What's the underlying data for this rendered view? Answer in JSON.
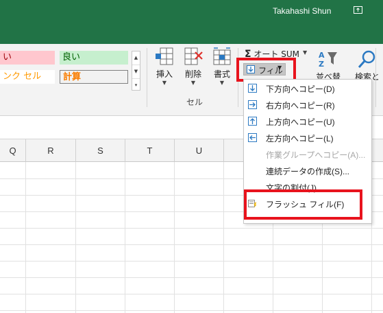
{
  "titlebar": {
    "user_name": "Takahashi Shun",
    "share_icon": "share-icon",
    "bg_color": "#217346"
  },
  "styles": {
    "bad_label": "い",
    "good_label": "良い",
    "link_label": "ンク セル",
    "calc_label": "計算"
  },
  "cells_group": {
    "insert_label": "挿入",
    "delete_label": "削除",
    "format_label": "書式",
    "group_label": "セル"
  },
  "editing_group": {
    "autosum_label": "オート SUM",
    "fill_label": "フィル",
    "sort_label": "並べ替えと",
    "find_label": "検索と"
  },
  "columns": [
    "Q",
    "R",
    "S",
    "T",
    "U"
  ],
  "fill_menu": {
    "items": [
      {
        "label": "下方向へコピー(D)",
        "icon": "arrow-down-icon",
        "enabled": true
      },
      {
        "label": "右方向へコピー(R)",
        "icon": "arrow-right-icon",
        "enabled": true
      },
      {
        "label": "上方向へコピー(U)",
        "icon": "arrow-up-icon",
        "enabled": true
      },
      {
        "label": "左方向へコピー(L)",
        "icon": "arrow-left-icon",
        "enabled": true
      },
      {
        "label": "作業グループへコピー(A)...",
        "icon": "",
        "enabled": false
      },
      {
        "label": "連続データの作成(S)...",
        "icon": "",
        "enabled": true
      },
      {
        "label": "文字の割付(J)",
        "icon": "",
        "enabled": true
      },
      {
        "label": "フラッシュ フィル(F)",
        "icon": "flash-fill-icon",
        "enabled": true
      }
    ]
  },
  "colors": {
    "highlight": "#e8131d",
    "excel_green": "#217346"
  }
}
